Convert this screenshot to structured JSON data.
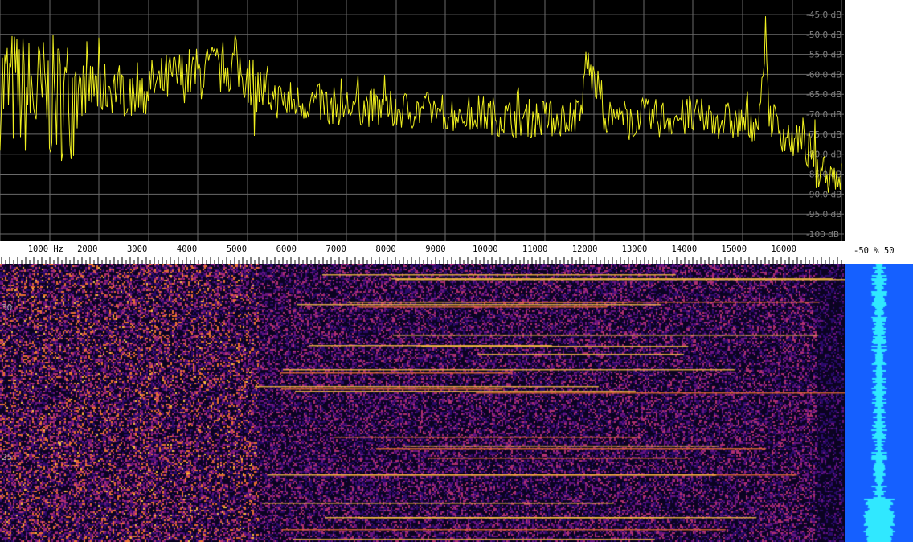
{
  "chart_data": [
    {
      "type": "line",
      "title": "",
      "xlabel": "",
      "ylabel": "",
      "x_unit": "Hz",
      "xlim": [
        0,
        17000
      ],
      "ylim": [
        -101,
        -43
      ],
      "y_tick_labels": [
        "-45.0 dB",
        "-50.0 dB",
        "-55.0 dB",
        "-60.0 dB",
        "-65.0 dB",
        "-70.0 dB",
        "-75.0 dB",
        "-80.0 dB",
        "-85.0 dB",
        "-90.0 dB",
        "-95.0 dB",
        "-100 dB"
      ],
      "y_ticks": [
        -45,
        -50,
        -55,
        -60,
        -65,
        -70,
        -75,
        -80,
        -85,
        -90,
        -95,
        -100
      ],
      "x_tick_labels": [
        "1000 Hz",
        "2000",
        "3000",
        "4000",
        "5000",
        "6000",
        "7000",
        "8000",
        "9000",
        "10000",
        "11000",
        "12000",
        "13000",
        "14000",
        "15000",
        "16000"
      ],
      "x_ticks": [
        1000,
        2000,
        3000,
        4000,
        5000,
        6000,
        7000,
        8000,
        9000,
        10000,
        11000,
        12000,
        13000,
        14000,
        15000,
        16000
      ],
      "grid": true,
      "line_color": "#f0f020",
      "series": [
        {
          "x": [
            0,
            250,
            500,
            750,
            1000,
            1250,
            1500,
            1750,
            2000,
            2250,
            2500,
            2750,
            3000,
            3250,
            3500,
            3750,
            4000,
            4250,
            4500,
            4750,
            5000,
            5250,
            5500,
            5750,
            6000,
            6500,
            7000,
            7500,
            8000,
            8500,
            9000,
            9500,
            10000,
            10500,
            11000,
            11500,
            11950,
            12000,
            12500,
            13000,
            13500,
            14000,
            14500,
            15000,
            15500,
            15650,
            15700,
            16000,
            16250,
            16500,
            16750,
            16900
          ],
          "y": [
            -66,
            -63,
            -64,
            -65,
            -66,
            -66,
            -66,
            -65,
            -63,
            -64,
            -63,
            -64,
            -63,
            -63,
            -62,
            -61,
            -60,
            -60,
            -59,
            -58,
            -58,
            -61,
            -64,
            -66,
            -67,
            -67,
            -68,
            -68,
            -69,
            -69,
            -69,
            -70,
            -70,
            -71,
            -71,
            -71,
            -70,
            -56,
            -71,
            -71,
            -71,
            -71,
            -71,
            -72,
            -72,
            -50,
            -70,
            -75,
            -77,
            -79,
            -82,
            -85
          ]
        }
      ]
    },
    {
      "type": "heatmap",
      "title": "",
      "xlim": [
        0,
        17000
      ],
      "time_tick_labels": [
        "30",
        "25"
      ],
      "colormap": [
        "#0b0321",
        "#2a0a6a",
        "#6a1480",
        "#b03070",
        "#e87030",
        "#f8c040"
      ]
    }
  ],
  "level_meter": {
    "scale_label": "-50  %  50",
    "fill_color": "#1560ff",
    "trace_color": "#30e8ff"
  }
}
